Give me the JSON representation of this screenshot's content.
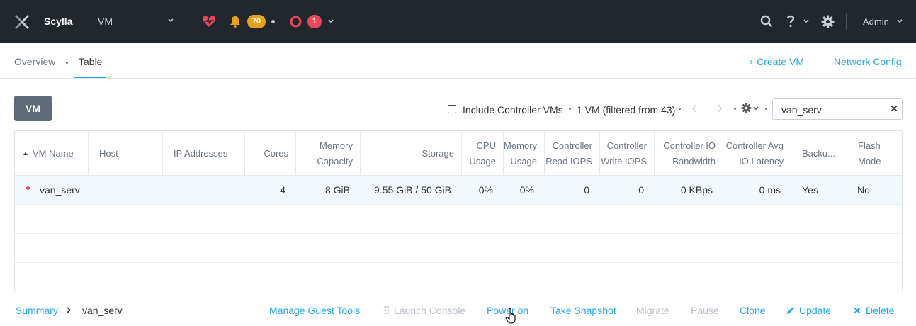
{
  "topbar": {
    "cluster_name": "Scylla",
    "view_label": "VM",
    "alert_count": "70",
    "event_count": "1",
    "user_label": "Admin"
  },
  "subnav": {
    "tabs": [
      {
        "label": "Overview"
      },
      {
        "label": "Table"
      }
    ],
    "active_tab": "Table",
    "create_vm_label": "Create VM",
    "network_config_label": "Network Config"
  },
  "toolbar": {
    "entity_button_label": "VM",
    "include_controller_label": "Include Controller VMs",
    "include_controller_checked": false,
    "vm_count_label": "1 VM (filtered from 43)",
    "search_value": "van_serv"
  },
  "table": {
    "columns": [
      {
        "label": "VM Name"
      },
      {
        "label": "Host"
      },
      {
        "label": "IP Addresses"
      },
      {
        "label": "Cores"
      },
      {
        "label": "Memory\nCapacity"
      },
      {
        "label": "Storage"
      },
      {
        "label": "CPU\nUsage"
      },
      {
        "label": "Memory\nUsage"
      },
      {
        "label": "Controller\nRead IOPS"
      },
      {
        "label": "Controller\nWrite IOPS"
      },
      {
        "label": "Controller IO\nBandwidth"
      },
      {
        "label": "Controller Avg\nIO Latency"
      },
      {
        "label": "Backu..."
      },
      {
        "label": "Flash\nMode"
      }
    ],
    "rows": [
      {
        "vm_name": "van_serv",
        "host": "",
        "ip_addresses": "",
        "cores": "4",
        "memory_capacity": "8 GiB",
        "storage": "9.55 GiB / 50 GiB",
        "cpu_usage": "0%",
        "memory_usage": "0%",
        "read_iops": "0",
        "write_iops": "0",
        "io_bandwidth": "0 KBps",
        "io_latency": "0 ms",
        "backup": "Yes",
        "flash_mode": "No"
      }
    ]
  },
  "bottom": {
    "breadcrumb_summary": "Summary",
    "breadcrumb_current": "van_serv",
    "actions": {
      "manage_guest_tools": "Manage Guest Tools",
      "launch_console": "Launch Console",
      "power_on": "Power on",
      "take_snapshot": "Take Snapshot",
      "migrate": "Migrate",
      "pause": "Pause",
      "clone": "Clone",
      "update": "Update",
      "delete": "Delete"
    }
  },
  "colors": {
    "topbar_bg": "#22272e",
    "accent": "#22a5f7",
    "alert_badge": "#e6a21d",
    "critical": "#e6475a",
    "disabled": "#b9c0c8"
  },
  "icons": [
    "x-logo-icon",
    "chevron-down-icon",
    "heartbeat-icon",
    "bell-icon",
    "ring-icon",
    "search-icon",
    "help-icon",
    "gear-icon",
    "plus-icon",
    "chevron-left-icon",
    "chevron-right-icon",
    "close-icon",
    "sort-asc-icon",
    "console-icon",
    "pencil-icon",
    "delete-x-icon",
    "hand-cursor-icon"
  ]
}
